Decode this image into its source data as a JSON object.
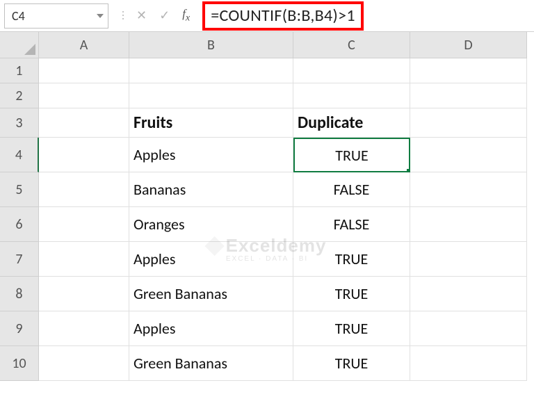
{
  "name_box": "C4",
  "formula": "=COUNTIF(B:B,B4)>1",
  "columns": [
    "A",
    "B",
    "C",
    "D"
  ],
  "row_numbers": [
    1,
    2,
    3,
    4,
    5,
    6,
    7,
    8,
    9,
    10
  ],
  "active_cell": {
    "row": 4,
    "col": "C"
  },
  "headers": {
    "b3": "Fruits",
    "c3": "Duplicate"
  },
  "rows": [
    {
      "fruit": "Apples",
      "dup": "TRUE"
    },
    {
      "fruit": "Bananas",
      "dup": "FALSE"
    },
    {
      "fruit": "Oranges",
      "dup": "FALSE"
    },
    {
      "fruit": "Apples",
      "dup": "TRUE"
    },
    {
      "fruit": "Green Bananas",
      "dup": "TRUE"
    },
    {
      "fruit": "Apples",
      "dup": "TRUE"
    },
    {
      "fruit": "Green Bananas",
      "dup": "TRUE"
    }
  ],
  "watermark": {
    "brand": "Exceldemy",
    "tagline": "EXCEL · DATA · BI"
  }
}
